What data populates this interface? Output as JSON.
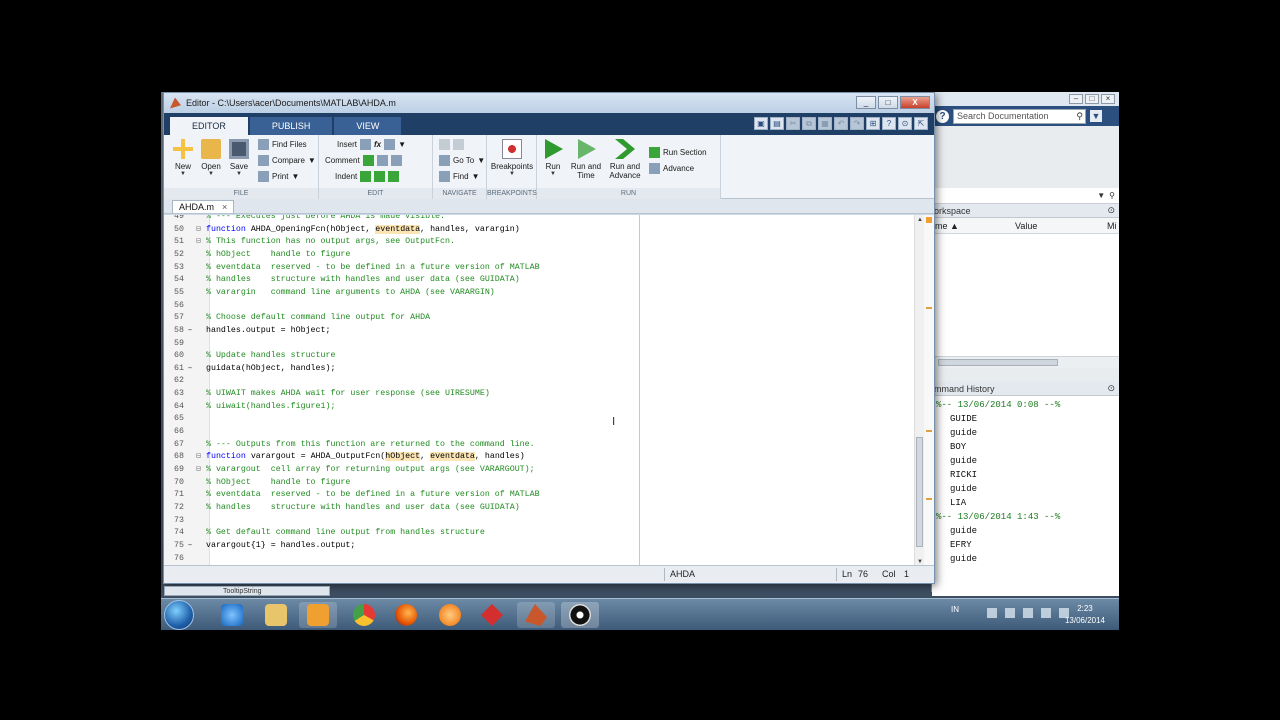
{
  "editor": {
    "title": "Editor - C:\\Users\\acer\\Documents\\MATLAB\\AHDA.m",
    "window_controls": [
      "_",
      "□",
      "X"
    ],
    "tabs": [
      "EDITOR",
      "PUBLISH",
      "VIEW"
    ],
    "file_group": {
      "new": "New",
      "open": "Open",
      "save": "Save",
      "find_files": "Find Files",
      "compare": "Compare",
      "print": "Print",
      "label": "FILE"
    },
    "edit_group": {
      "insert": "Insert",
      "comment": "Comment",
      "indent": "Indent",
      "label": "EDIT",
      "fx": "fx"
    },
    "navigate_group": {
      "goto": "Go To",
      "find": "Find",
      "label": "NAVIGATE"
    },
    "breakpoints_group": {
      "breakpoints": "Breakpoints",
      "label": "BREAKPOINTS"
    },
    "run_group": {
      "run": "Run",
      "run_time_1": "Run and",
      "run_time_2": "Time",
      "run_adv_1": "Run and",
      "run_adv_2": "Advance",
      "run_section": "Run Section",
      "advance": "Advance",
      "label": "RUN"
    },
    "file_tab": {
      "name": "AHDA.m",
      "close": "×"
    }
  },
  "code_lines": [
    {
      "n": "49",
      "mk": "",
      "t": [
        [
          "cm",
          "% --- Executes just before AHDA is made visible."
        ]
      ]
    },
    {
      "n": "50",
      "mk": "",
      "fold": "⊟",
      "t": [
        [
          "kw",
          "function"
        ],
        [
          "",
          " AHDA_OpeningFcn(hObject, "
        ],
        [
          "hl",
          "eventdata"
        ],
        [
          "",
          ", handles, varargin)"
        ]
      ]
    },
    {
      "n": "51",
      "mk": "",
      "fold": "⊟",
      "t": [
        [
          "cm",
          "% This function has no output args, see OutputFcn."
        ]
      ]
    },
    {
      "n": "52",
      "mk": "",
      "t": [
        [
          "cm",
          "% hObject    handle to figure"
        ]
      ]
    },
    {
      "n": "53",
      "mk": "",
      "t": [
        [
          "cm",
          "% eventdata  reserved - to be defined in a future version of MATLAB"
        ]
      ]
    },
    {
      "n": "54",
      "mk": "",
      "t": [
        [
          "cm",
          "% handles    structure with handles and user data (see GUIDATA)"
        ]
      ]
    },
    {
      "n": "55",
      "mk": "",
      "t": [
        [
          "cm",
          "% varargin   command line arguments to AHDA (see VARARGIN)"
        ]
      ]
    },
    {
      "n": "56",
      "mk": "",
      "t": [
        [
          "",
          ""
        ]
      ]
    },
    {
      "n": "57",
      "mk": "",
      "t": [
        [
          "cm",
          "% Choose default command line output for AHDA"
        ]
      ]
    },
    {
      "n": "58",
      "mk": "–",
      "t": [
        [
          "",
          "handles.output = hObject;"
        ]
      ]
    },
    {
      "n": "59",
      "mk": "",
      "t": [
        [
          "",
          ""
        ]
      ]
    },
    {
      "n": "60",
      "mk": "",
      "t": [
        [
          "cm",
          "% Update handles structure"
        ]
      ]
    },
    {
      "n": "61",
      "mk": "–",
      "t": [
        [
          "",
          "guidata(hObject, handles);"
        ]
      ]
    },
    {
      "n": "62",
      "mk": "",
      "t": [
        [
          "",
          ""
        ]
      ]
    },
    {
      "n": "63",
      "mk": "",
      "t": [
        [
          "cm",
          "% UIWAIT makes AHDA wait for user response (see UIRESUME)"
        ]
      ]
    },
    {
      "n": "64",
      "mk": "",
      "t": [
        [
          "cm",
          "% uiwait(handles.figure1);"
        ]
      ]
    },
    {
      "n": "65",
      "mk": "",
      "t": [
        [
          "",
          ""
        ]
      ]
    },
    {
      "n": "66",
      "mk": "",
      "t": [
        [
          "",
          ""
        ]
      ]
    },
    {
      "n": "67",
      "mk": "",
      "t": [
        [
          "cm",
          "% --- Outputs from this function are returned to the command line."
        ]
      ]
    },
    {
      "n": "68",
      "mk": "",
      "fold": "⊟",
      "t": [
        [
          "kw",
          "function"
        ],
        [
          "",
          " varargout = AHDA_OutputFcn("
        ],
        [
          "hl",
          "hObject"
        ],
        [
          "",
          ", "
        ],
        [
          "hl",
          "eventdata"
        ],
        [
          "",
          ", handles)"
        ]
      ]
    },
    {
      "n": "69",
      "mk": "",
      "fold": "⊟",
      "t": [
        [
          "cm",
          "% varargout  cell array for returning output args (see VARARGOUT);"
        ]
      ]
    },
    {
      "n": "70",
      "mk": "",
      "t": [
        [
          "cm",
          "% hObject    handle to figure"
        ]
      ]
    },
    {
      "n": "71",
      "mk": "",
      "t": [
        [
          "cm",
          "% eventdata  reserved - to be defined in a future version of MATLAB"
        ]
      ]
    },
    {
      "n": "72",
      "mk": "",
      "t": [
        [
          "cm",
          "% handles    structure with handles and user data (see GUIDATA)"
        ]
      ]
    },
    {
      "n": "73",
      "mk": "",
      "t": [
        [
          "",
          ""
        ]
      ]
    },
    {
      "n": "74",
      "mk": "",
      "t": [
        [
          "cm",
          "% Get default command line output from handles structure"
        ]
      ]
    },
    {
      "n": "75",
      "mk": "–",
      "t": [
        [
          "",
          "varargout{1} = handles.output;"
        ]
      ]
    },
    {
      "n": "76",
      "mk": "",
      "t": [
        [
          "",
          ""
        ]
      ]
    }
  ],
  "status": {
    "file": "AHDA",
    "ln_label": "Ln",
    "ln": "76",
    "col_label": "Col",
    "col": "1"
  },
  "tooltip_tab": "TooltipString",
  "main_window": {
    "search_placeholder": "Search Documentation",
    "workspace_title": "orkspace",
    "col_name": "me ▲",
    "col_value": "Value",
    "col_extra": "Mi",
    "history_title": "mmand History",
    "history": [
      {
        "type": "stamp",
        "text": "%-- 13/06/2014 0:08 --%"
      },
      {
        "type": "cmd",
        "text": "GUIDE"
      },
      {
        "type": "cmd",
        "text": "guide"
      },
      {
        "type": "cmd",
        "text": "BOY"
      },
      {
        "type": "cmd",
        "text": "guide"
      },
      {
        "type": "cmd",
        "text": "RICKI"
      },
      {
        "type": "cmd",
        "text": "guide"
      },
      {
        "type": "cmd",
        "text": "LIA"
      },
      {
        "type": "stamp",
        "text": "%-- 13/06/2014 1:43 --%"
      },
      {
        "type": "cmd",
        "text": "guide"
      },
      {
        "type": "cmd",
        "text": "EFRY"
      },
      {
        "type": "cmd",
        "text": "guide"
      }
    ]
  },
  "taskbar": {
    "lang": "IN",
    "time": "2:23",
    "date": "13/06/2014",
    "apps": [
      "ie-icon",
      "explorer-icon",
      "media-player-icon",
      "chrome-icon",
      "firefox-icon",
      "orange-app-icon",
      "flashget-icon",
      "matlab-icon",
      "camera-app-icon"
    ]
  },
  "colors": {
    "keyword": "#0000ff",
    "comment": "#228b22",
    "highlight": "#fbe5b4",
    "ribbon_tabs": "#1f3f66"
  }
}
